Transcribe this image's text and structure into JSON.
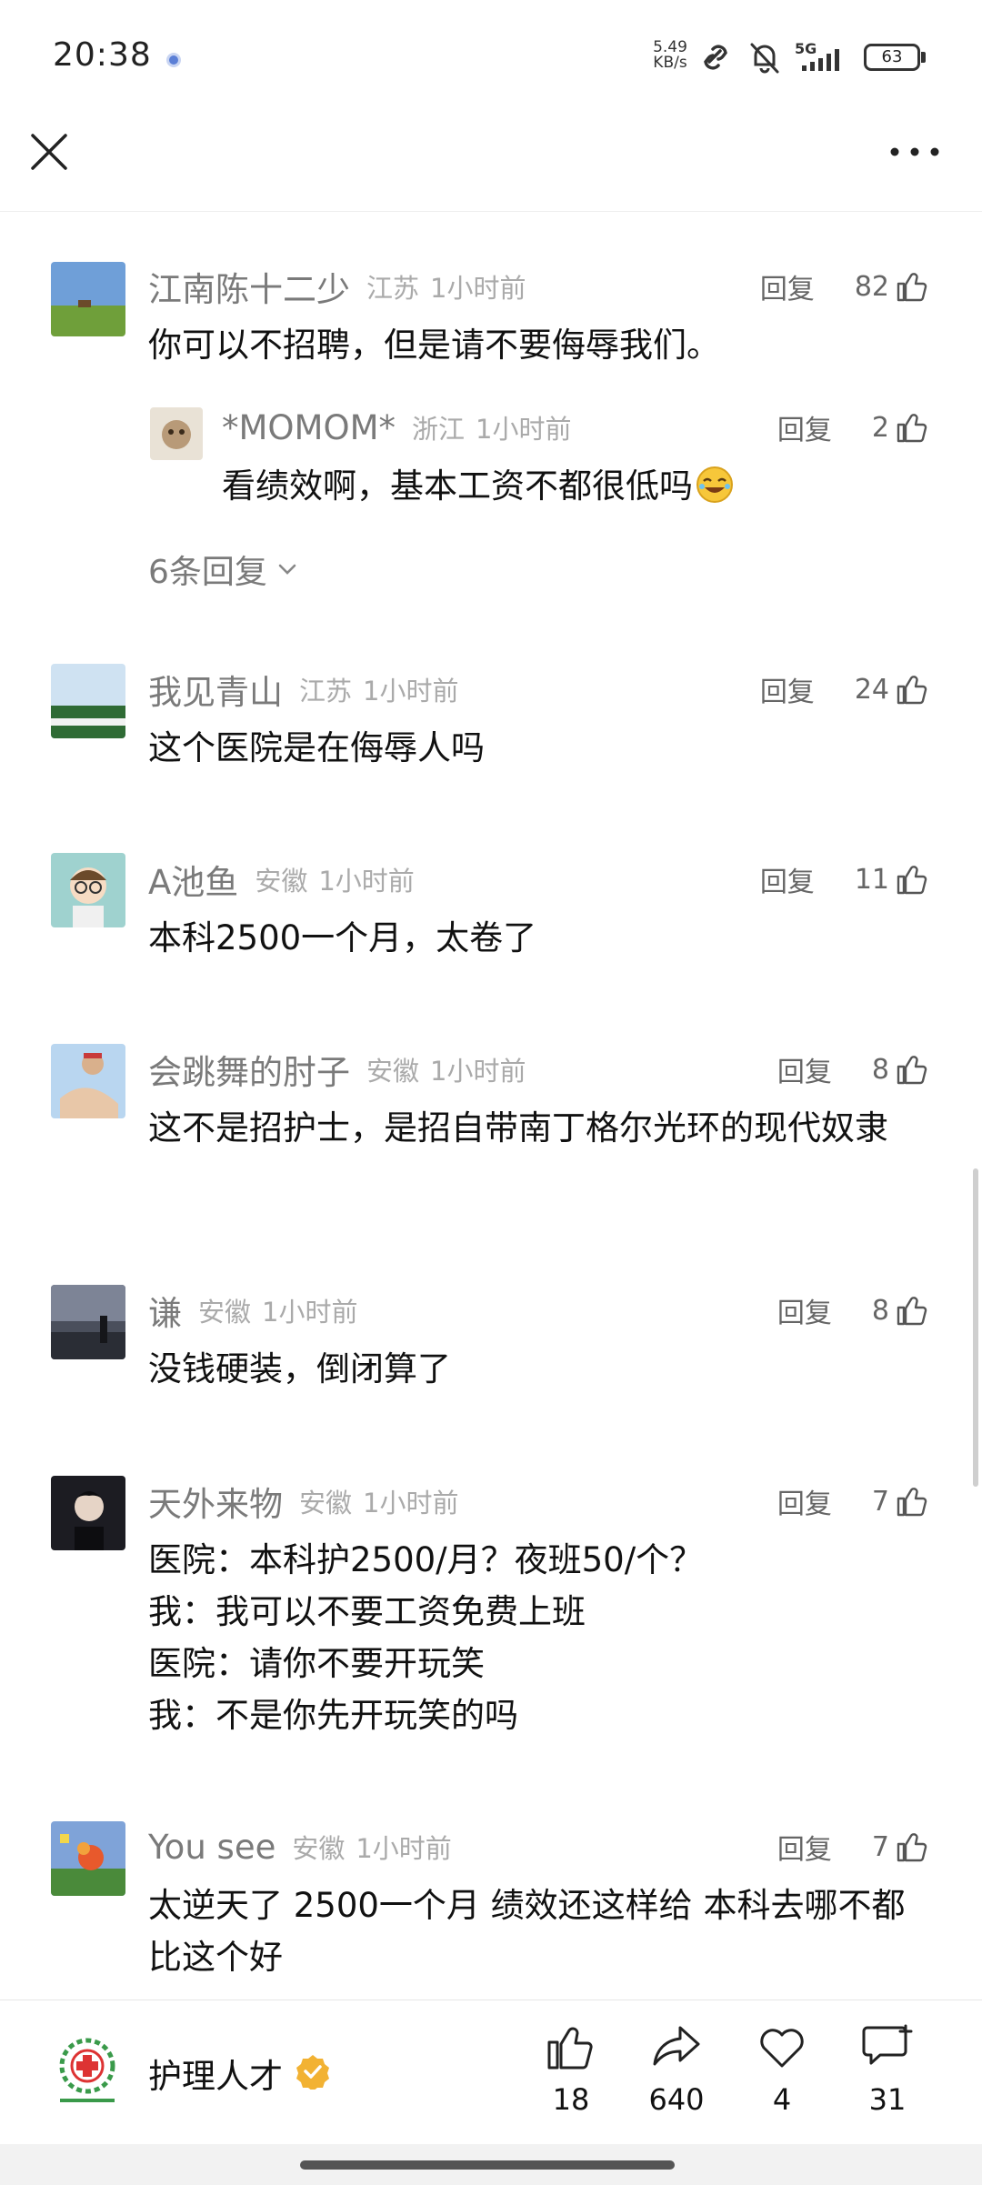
{
  "status_bar": {
    "time": "20:38",
    "net_speed_value": "5.49",
    "net_speed_unit": "KB/s",
    "network": "5G",
    "battery": "63"
  },
  "comments": [
    {
      "name": "江南陈十二少",
      "location": "江苏",
      "time": "1小时前",
      "reply_label": "回复",
      "likes": "82",
      "text": "你可以不招聘，但是请不要侮辱我们。",
      "replies": [
        {
          "name": "*MOMOM*",
          "location": "浙江",
          "time": "1小时前",
          "reply_label": "回复",
          "likes": "2",
          "text": "看绩效啊，基本工资不都很低吗"
        }
      ],
      "more_replies": "6条回复"
    },
    {
      "name": "我见青山",
      "location": "江苏",
      "time": "1小时前",
      "reply_label": "回复",
      "likes": "24",
      "text": "这个医院是在侮辱人吗"
    },
    {
      "name": "A池鱼",
      "location": "安徽",
      "time": "1小时前",
      "reply_label": "回复",
      "likes": "11",
      "text": "本科2500一个月，太卷了"
    },
    {
      "name": "会跳舞的肘子",
      "location": "安徽",
      "time": "1小时前",
      "reply_label": "回复",
      "likes": "8",
      "text": "这不是招护士，是招自带南丁格尔光环的现代奴隶"
    },
    {
      "name": "谦",
      "location": "安徽",
      "time": "1小时前",
      "reply_label": "回复",
      "likes": "8",
      "text": "没钱硬装，倒闭算了"
    },
    {
      "name": "天外来物",
      "location": "安徽",
      "time": "1小时前",
      "reply_label": "回复",
      "likes": "7",
      "lines": [
        "医院：本科护2500/月？夜班50/个？",
        "我：我可以不要工资免费上班",
        "医院：请你不要开玩笑",
        "我：不是你先开玩笑的吗"
      ]
    },
    {
      "name": "You see",
      "location": "安徽",
      "time": "1小时前",
      "reply_label": "回复",
      "likes": "7",
      "text": "太逆天了 2500一个月 绩效还这样给 本科去哪不都比这个好"
    }
  ],
  "bottom_bar": {
    "account_name": "护理人才",
    "likes": "18",
    "shares": "640",
    "favorites": "4",
    "comments": "31"
  },
  "colors": {
    "verified_badge": "#f2b233",
    "text_secondary": "#7a7a7a",
    "text_meta": "#aaaaaa"
  }
}
